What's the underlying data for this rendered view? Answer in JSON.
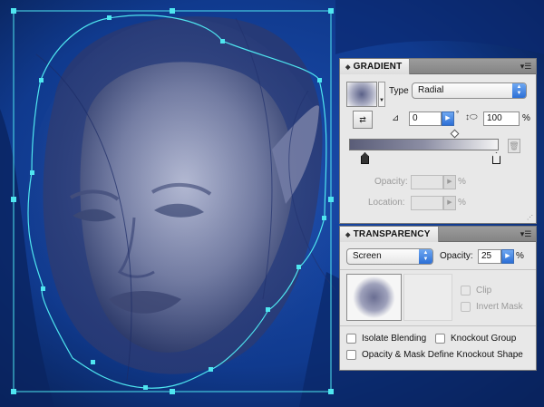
{
  "gradient_panel": {
    "tab_label": "GRADIENT",
    "type_label": "Type",
    "type_value": "Radial",
    "angle_value": "0",
    "angle_unit": "°",
    "aspect_value": "100",
    "aspect_unit": "%",
    "opacity_label": "Opacity:",
    "opacity_unit": "%",
    "location_label": "Location:",
    "location_unit": "%"
  },
  "transparency_panel": {
    "tab_label": "TRANSPARENCY",
    "blend_mode": "Screen",
    "opacity_label": "Opacity:",
    "opacity_value": "25",
    "opacity_unit": "%",
    "clip_label": "Clip",
    "invert_mask_label": "Invert Mask",
    "isolate_blending_label": "Isolate Blending",
    "knockout_group_label": "Knockout Group",
    "opacity_mask_label": "Opacity & Mask Define Knockout Shape"
  },
  "colors": {
    "background_blue": "#0d2a6a",
    "selection_cyan": "#4fe6f0",
    "face_tone": "#7f88ab",
    "accent_blue": "#2c6fd6"
  }
}
